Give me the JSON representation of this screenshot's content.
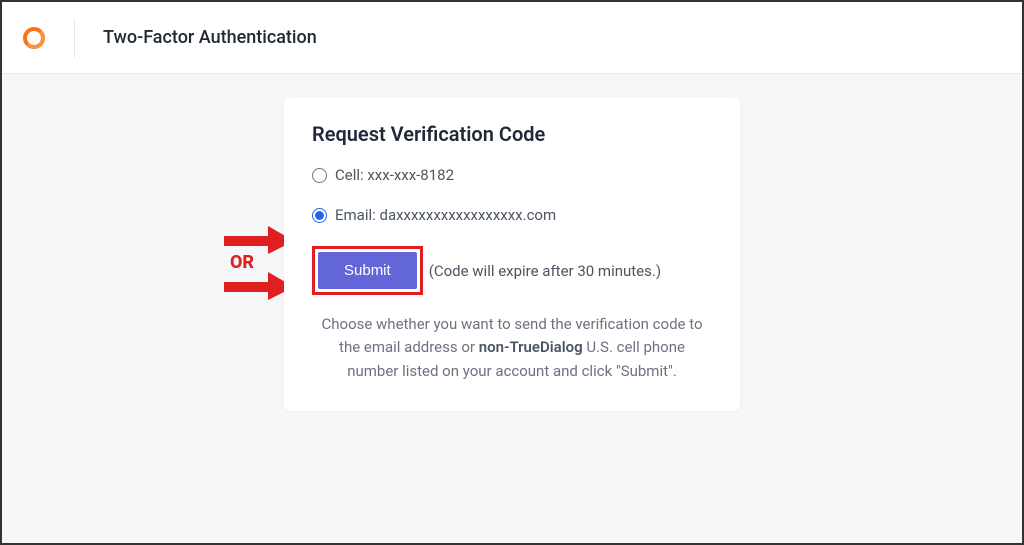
{
  "header": {
    "title": "Two-Factor Authentication"
  },
  "card": {
    "title": "Request Verification Code",
    "options": [
      {
        "label": "Cell: xxx-xxx-8182",
        "checked": false
      },
      {
        "label": "Email: daxxxxxxxxxxxxxxxxx.com",
        "checked": true
      }
    ],
    "submit_label": "Submit",
    "expire_text": "(Code will expire after 30 minutes.)",
    "helper_pre": "Choose whether you want to send the verification code to the email address or ",
    "helper_bold": "non-TrueDialog",
    "helper_post": " U.S. cell phone number listed on your account and click \"Submit\"."
  },
  "annotations": {
    "or_label": "OR"
  }
}
